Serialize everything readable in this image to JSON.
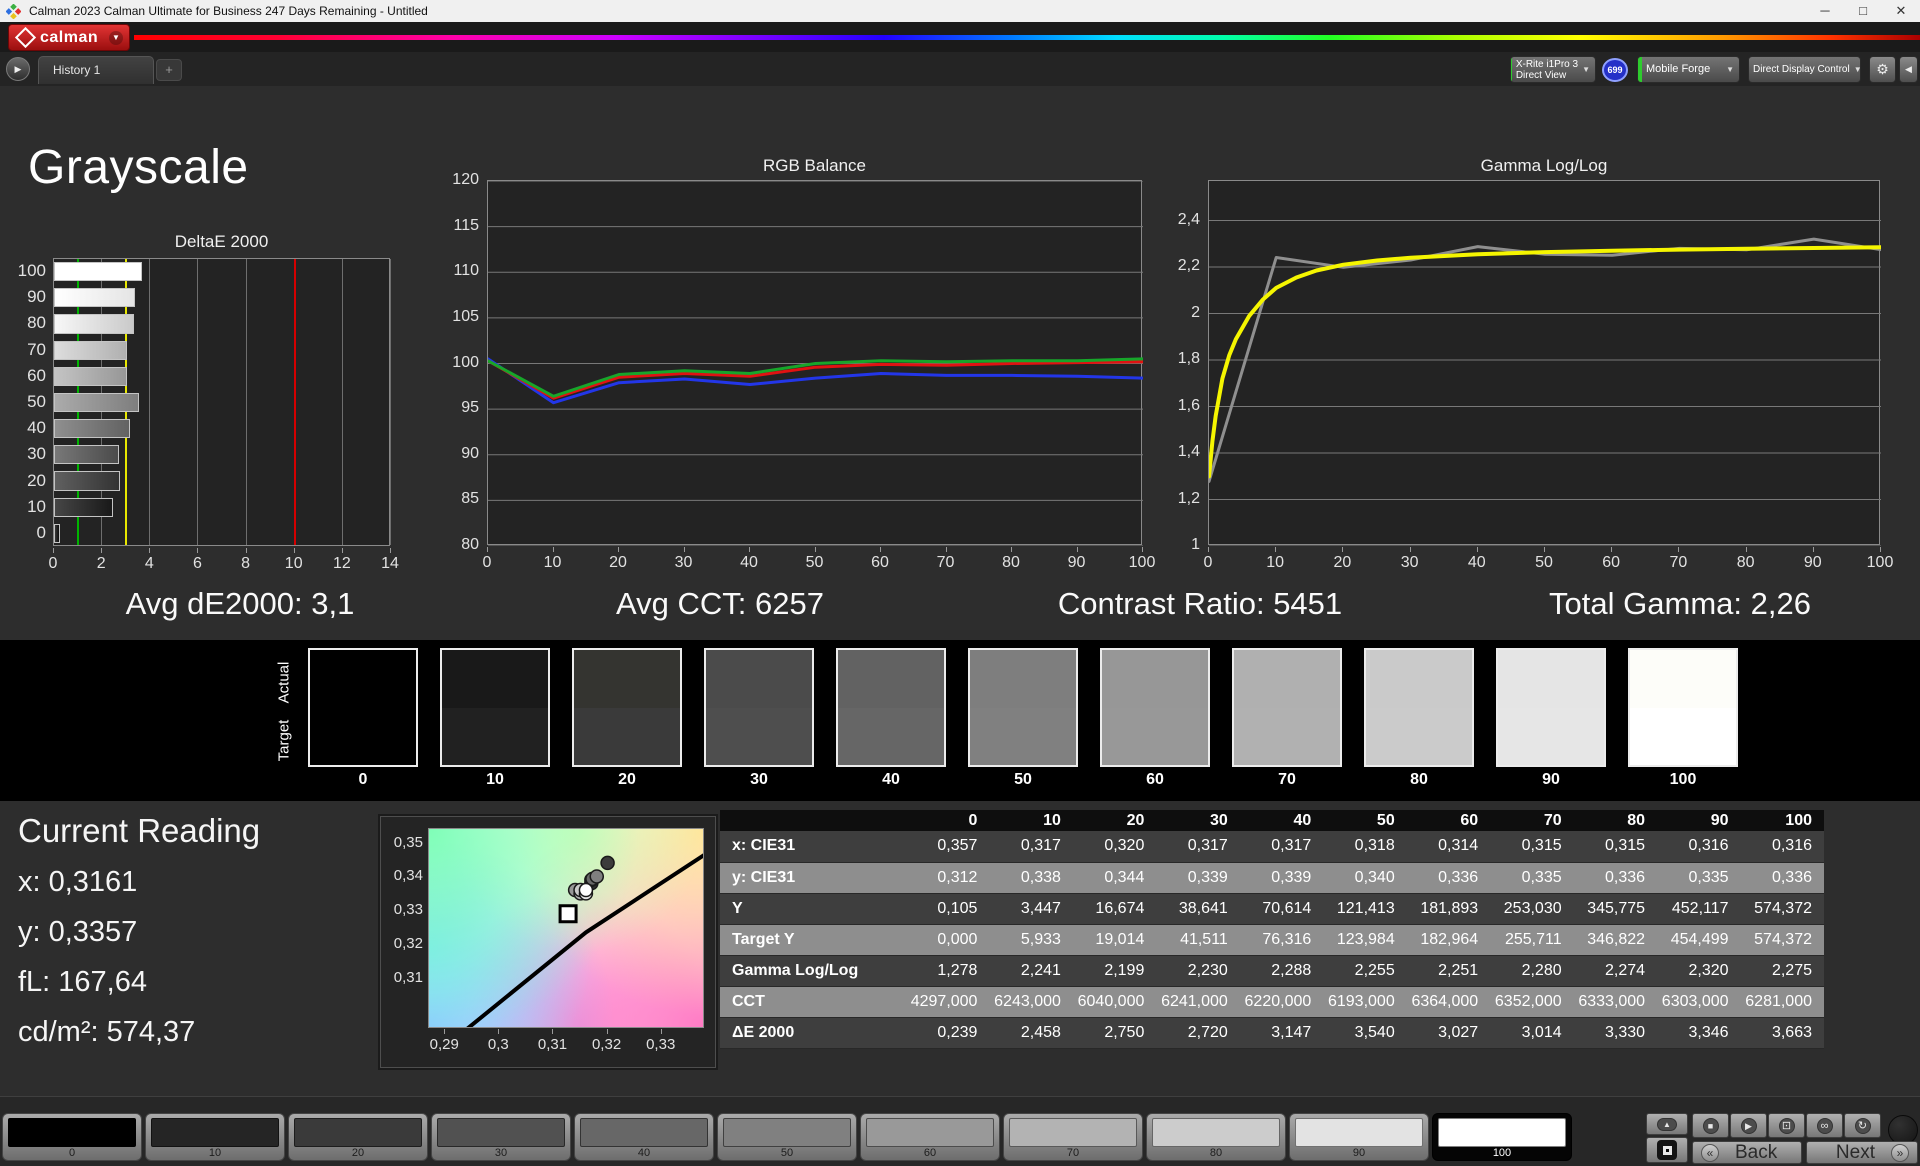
{
  "window": {
    "title": "Calman 2023 Calman Ultimate for Business 247 Days Remaining  - Untitled",
    "minimize": "─",
    "maximize": "□",
    "close": "✕"
  },
  "brand": {
    "logo_text": "calman"
  },
  "icons": {
    "caret": "▼",
    "gear": "⚙",
    "collapse": "◀",
    "play": "▶",
    "plus": "+",
    "stop": "■",
    "frame": "⊡",
    "infinity": "∞",
    "loop": "↻",
    "up": "▲",
    "back_chev": "«",
    "next_chev": "»"
  },
  "toolbar": {
    "history_tab": "History 1",
    "meter": {
      "line1": "X-Rite i1Pro 3",
      "line2": "Direct View",
      "badge": "699",
      "edge_color": "#2ecc2e"
    },
    "source": {
      "label": "Mobile Forge",
      "edge_color": "#2ecc2e"
    },
    "display_control": {
      "label": "Direct Display Control",
      "edge_color": "#e8e800"
    }
  },
  "page": {
    "title": "Grayscale"
  },
  "summary": {
    "items": [
      "Avg dE2000: 3,1",
      "Avg CCT: 6257",
      "Contrast Ratio: 5451",
      "Total Gamma: 2,26"
    ]
  },
  "chart_data": [
    {
      "id": "deltae",
      "type": "bar",
      "title": "DeltaE 2000",
      "levels": [
        100,
        90,
        80,
        70,
        60,
        50,
        40,
        30,
        20,
        10,
        0
      ],
      "values": [
        3.663,
        3.346,
        3.33,
        3.014,
        3.027,
        3.54,
        3.147,
        2.72,
        2.75,
        2.458,
        0.239
      ],
      "bar_colors": [
        "#ffffff",
        "#e5e5e5",
        "#cacaca",
        "#b0b0b0",
        "#979797",
        "#7e7e7e",
        "#626262",
        "#4b4b4b",
        "#333333",
        "#191919",
        "#0d0d0d"
      ],
      "xlim": [
        0,
        14
      ],
      "xticks": [
        0,
        2,
        4,
        6,
        8,
        10,
        12,
        14
      ],
      "ref_lines": [
        {
          "value": 1,
          "color": "#00b400"
        },
        {
          "value": 3,
          "color": "#e8e800"
        },
        {
          "value": 10,
          "color": "#d40000"
        }
      ]
    },
    {
      "id": "rgb",
      "type": "line",
      "title": "RGB Balance",
      "x": [
        0,
        10,
        20,
        30,
        40,
        50,
        60,
        70,
        80,
        90,
        100
      ],
      "ylim": [
        80,
        120
      ],
      "yticks": [
        {
          "v": 120,
          "label": "120"
        },
        {
          "v": 115,
          "label": "115"
        },
        {
          "v": 110,
          "label": "110"
        },
        {
          "v": 105,
          "label": "105"
        },
        {
          "v": 100,
          "label": "100"
        },
        {
          "v": 95,
          "label": "95"
        },
        {
          "v": 90,
          "label": "90"
        },
        {
          "v": 85,
          "label": "85"
        },
        {
          "v": 80,
          "label": "80"
        }
      ],
      "xticks": [
        0,
        10,
        20,
        30,
        40,
        50,
        60,
        70,
        80,
        90,
        100
      ],
      "series": [
        {
          "name": "Blue",
          "color": "#2336e8",
          "width": 3,
          "values": [
            100.5,
            95.7,
            97.9,
            98.3,
            97.7,
            98.4,
            98.9,
            98.7,
            98.7,
            98.6,
            98.4
          ]
        },
        {
          "name": "Red",
          "color": "#e01212",
          "width": 3,
          "values": [
            100.3,
            96.2,
            98.5,
            98.9,
            98.6,
            99.6,
            99.9,
            99.8,
            100.0,
            100.1,
            100.2
          ]
        },
        {
          "name": "Green",
          "color": "#17a62a",
          "width": 3,
          "values": [
            100.3,
            96.4,
            98.8,
            99.2,
            98.9,
            100.0,
            100.3,
            100.2,
            100.3,
            100.3,
            100.5
          ]
        }
      ]
    },
    {
      "id": "gamma",
      "type": "line",
      "title": "Gamma Log/Log",
      "x": [
        0,
        10,
        20,
        30,
        40,
        50,
        60,
        70,
        80,
        90,
        100
      ],
      "ylim": [
        1,
        2.57
      ],
      "yticks": [
        {
          "v": 2.4,
          "label": "2,4"
        },
        {
          "v": 2.2,
          "label": "2,2"
        },
        {
          "v": 2.0,
          "label": "2"
        },
        {
          "v": 1.8,
          "label": "1,8"
        },
        {
          "v": 1.6,
          "label": "1,6"
        },
        {
          "v": 1.4,
          "label": "1,4"
        },
        {
          "v": 1.2,
          "label": "1,2"
        },
        {
          "v": 1.0,
          "label": "1"
        }
      ],
      "xticks": [
        0,
        10,
        20,
        30,
        40,
        50,
        60,
        70,
        80,
        90,
        100
      ],
      "series": [
        {
          "name": "Measured",
          "color": "#8f8f8f",
          "width": 3,
          "values": [
            1.278,
            2.241,
            2.199,
            2.23,
            2.288,
            2.255,
            2.251,
            2.28,
            2.274,
            2.32,
            2.275
          ]
        },
        {
          "name": "Target",
          "color": "#f5f500",
          "width": 4,
          "x": [
            0,
            0.5,
            1,
            2,
            3,
            4,
            6,
            8,
            10,
            13,
            16,
            20,
            25,
            30,
            40,
            50,
            60,
            70,
            80,
            90,
            100
          ],
          "values": [
            1.3,
            1.45,
            1.56,
            1.72,
            1.82,
            1.89,
            1.99,
            2.06,
            2.11,
            2.155,
            2.185,
            2.21,
            2.228,
            2.24,
            2.255,
            2.264,
            2.27,
            2.275,
            2.279,
            2.282,
            2.285
          ]
        }
      ]
    },
    {
      "id": "cie",
      "type": "scatter",
      "title": "CIE xy",
      "xlim": [
        0.287,
        0.338
      ],
      "ylim": [
        0.295,
        0.354
      ],
      "xticks": [
        {
          "v": 0.29,
          "label": "0,29"
        },
        {
          "v": 0.3,
          "label": "0,3"
        },
        {
          "v": 0.31,
          "label": "0,31"
        },
        {
          "v": 0.32,
          "label": "0,32"
        },
        {
          "v": 0.33,
          "label": "0,33"
        }
      ],
      "yticks": [
        {
          "v": 0.35,
          "label": "0,35"
        },
        {
          "v": 0.34,
          "label": "0,34"
        },
        {
          "v": 0.33,
          "label": "0,33"
        },
        {
          "v": 0.32,
          "label": "0,32"
        },
        {
          "v": 0.31,
          "label": "0,31"
        }
      ],
      "locus": [
        [
          0.294,
          0.295
        ],
        [
          0.316,
          0.3235
        ],
        [
          0.338,
          0.3465
        ]
      ],
      "target_marker": {
        "x": 0.3127,
        "y": 0.329
      },
      "points": [
        {
          "x": 0.317,
          "y": 0.338,
          "color": "#2e2e2e"
        },
        {
          "x": 0.32,
          "y": 0.344,
          "color": "#3c3c3c"
        },
        {
          "x": 0.317,
          "y": 0.339,
          "color": "#525252"
        },
        {
          "x": 0.3172,
          "y": 0.3393,
          "color": "#686868"
        },
        {
          "x": 0.318,
          "y": 0.34,
          "color": "#7f7f7f"
        },
        {
          "x": 0.314,
          "y": 0.336,
          "color": "#979797"
        },
        {
          "x": 0.315,
          "y": 0.335,
          "color": "#b0b0b0"
        },
        {
          "x": 0.315,
          "y": 0.336,
          "color": "#cacaca"
        },
        {
          "x": 0.316,
          "y": 0.335,
          "color": "#e5e5e5"
        },
        {
          "x": 0.316,
          "y": 0.336,
          "color": "#ffffff"
        }
      ]
    }
  ],
  "patches": {
    "row_labels": [
      "Actual",
      "Target"
    ],
    "levels": [
      "0",
      "10",
      "20",
      "30",
      "40",
      "50",
      "60",
      "70",
      "80",
      "90",
      "100"
    ],
    "actual": [
      "#000000",
      "#191919",
      "#343430",
      "#4b4b4b",
      "#626262",
      "#7e7e7e",
      "#979797",
      "#b0b0b0",
      "#cacaca",
      "#e5e5e5",
      "#fdfdf9"
    ],
    "target": [
      "#000000",
      "#212121",
      "#3a3a3a",
      "#4e4e4e",
      "#666666",
      "#808080",
      "#989898",
      "#b1b1b1",
      "#cbcbcb",
      "#e6e6e6",
      "#ffffff"
    ]
  },
  "current_reading": {
    "title": "Current Reading",
    "lines": [
      "x: 0,3161",
      "y: 0,3357",
      "fL: 167,64",
      "cd/m²: 574,37"
    ]
  },
  "table": {
    "headers": [
      "",
      "0",
      "10",
      "20",
      "30",
      "40",
      "50",
      "60",
      "70",
      "80",
      "90",
      "100"
    ],
    "rows": [
      {
        "label": "x: CIE31",
        "values": [
          "0,357",
          "0,317",
          "0,320",
          "0,317",
          "0,317",
          "0,318",
          "0,314",
          "0,315",
          "0,315",
          "0,316",
          "0,316"
        ]
      },
      {
        "label": "y: CIE31",
        "values": [
          "0,312",
          "0,338",
          "0,344",
          "0,339",
          "0,339",
          "0,340",
          "0,336",
          "0,335",
          "0,336",
          "0,335",
          "0,336"
        ]
      },
      {
        "label": "Y",
        "values": [
          "0,105",
          "3,447",
          "16,674",
          "38,641",
          "70,614",
          "121,413",
          "181,893",
          "253,030",
          "345,775",
          "452,117",
          "574,372"
        ]
      },
      {
        "label": "Target Y",
        "values": [
          "0,000",
          "5,933",
          "19,014",
          "41,511",
          "76,316",
          "123,984",
          "182,964",
          "255,711",
          "346,822",
          "454,499",
          "574,372"
        ]
      },
      {
        "label": "Gamma Log/Log",
        "values": [
          "1,278",
          "2,241",
          "2,199",
          "2,230",
          "2,288",
          "2,255",
          "2,251",
          "2,280",
          "2,274",
          "2,320",
          "2,275"
        ]
      },
      {
        "label": "CCT",
        "values": [
          "4297,000",
          "6243,000",
          "6040,000",
          "6241,000",
          "6220,000",
          "6193,000",
          "6364,000",
          "6352,000",
          "6333,000",
          "6303,000",
          "6281,000"
        ]
      },
      {
        "label": "ΔE 2000",
        "values": [
          "0,239",
          "2,458",
          "2,750",
          "2,720",
          "3,147",
          "3,540",
          "3,027",
          "3,014",
          "3,330",
          "3,346",
          "3,663"
        ]
      }
    ]
  },
  "bottom_bar": {
    "levels": [
      "0",
      "10",
      "20",
      "30",
      "40",
      "50",
      "60",
      "70",
      "80",
      "90",
      "100"
    ],
    "colors": [
      "#000000",
      "#252525",
      "#3a3a3a",
      "#515151",
      "#676767",
      "#808080",
      "#999999",
      "#b3b3b3",
      "#cccccc",
      "#e3e3e3",
      "#ffffff"
    ],
    "selected": "100",
    "back_label": "Back",
    "next_label": "Next"
  }
}
